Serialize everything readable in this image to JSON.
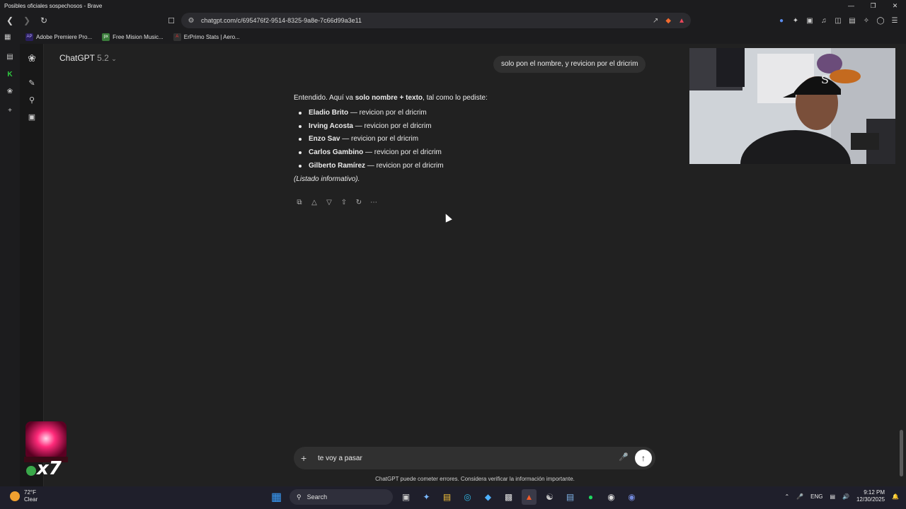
{
  "window": {
    "title": "Posibles oficiales sospechosos - Brave"
  },
  "browser": {
    "url": "chatgpt.com/c/695476f2-9514-8325-9a8e-7c66d99a3e11",
    "bookmarks": [
      {
        "label": "Adobe Premiere Pro...",
        "icon": "AP",
        "color": "#2a1f5e"
      },
      {
        "label": "Free Mision Music...",
        "icon": "px",
        "color": "#3b7d3b"
      },
      {
        "label": "ErPrimo Stats | Aero...",
        "icon": "A",
        "color": "#333333"
      }
    ]
  },
  "chatgpt": {
    "model_name": "ChatGPT",
    "model_version": "5.2",
    "user_message": "solo pon el nombre, y revicion por el dricrim",
    "assistant": {
      "intro_prefix": "Entendido. Aquí va ",
      "intro_bold": "solo nombre + texto",
      "intro_suffix": ", tal como lo pediste:",
      "items": [
        {
          "name": "Eladio Brito",
          "text": " — revicion por el dricrim"
        },
        {
          "name": "Irving Acosta",
          "text": " — revicion por el dricrim"
        },
        {
          "name": "Enzo Sav",
          "text": " — revicion por el dricrim"
        },
        {
          "name": "Carlos Gambino",
          "text": " — revicion por el dricrim"
        },
        {
          "name": "Gilberto Ramírez",
          "text": " — revicion por el dricrim"
        }
      ],
      "note": "(Listado informativo)."
    },
    "composer_text": "te voy a pasar",
    "disclaimer": "ChatGPT puede cometer errores. Considera verificar la información importante."
  },
  "overlay": {
    "multiplier": "x7"
  },
  "taskbar": {
    "temperature": "72°F",
    "weather": "Clear",
    "search_label": "Search",
    "language": "ENG",
    "time": "9:12 PM",
    "date": "12/30/2025"
  }
}
